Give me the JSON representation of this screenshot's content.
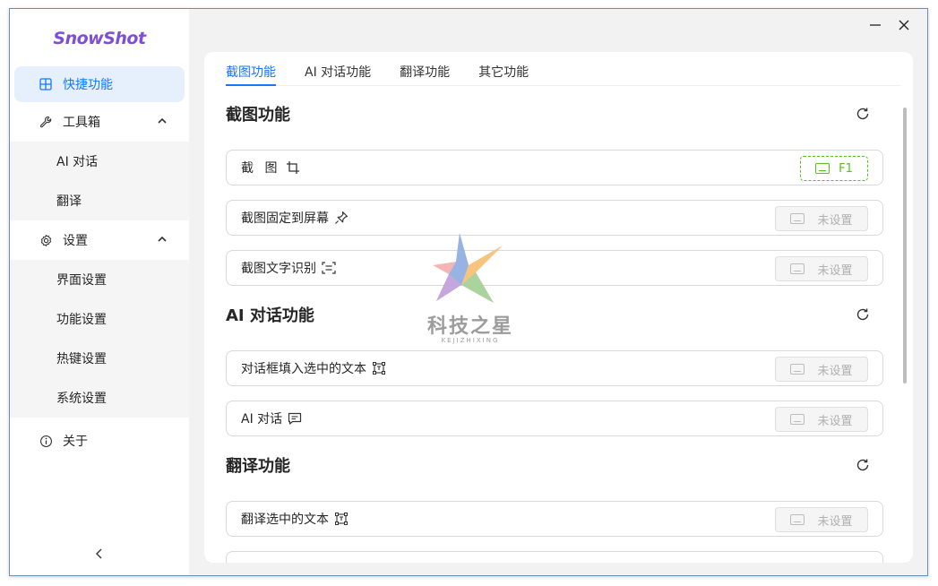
{
  "app": {
    "name": "SnowShot"
  },
  "sidebar": {
    "items": [
      {
        "label": "快捷功能",
        "icon": "layout-grid-icon",
        "active": true
      },
      {
        "label": "工具箱",
        "icon": "wrench-icon",
        "expanded": true,
        "children": [
          "AI 对话",
          "翻译"
        ]
      },
      {
        "label": "设置",
        "icon": "gear-icon",
        "expanded": true,
        "children": [
          "界面设置",
          "功能设置",
          "热键设置",
          "系统设置"
        ]
      },
      {
        "label": "关于",
        "icon": "info-icon"
      }
    ],
    "collapse_icon": "chevron-left-icon"
  },
  "tabs": [
    "截图功能",
    "AI 对话功能",
    "翻译功能",
    "其它功能"
  ],
  "active_tab": 0,
  "sections": [
    {
      "title": "截图功能",
      "rows": [
        {
          "label": "截 图",
          "icon": "crop-icon",
          "hotkey": "F1",
          "hotkey_set": true
        },
        {
          "label": "截图固定到屏幕",
          "icon": "pin-icon",
          "hotkey": "未设置",
          "hotkey_set": false
        },
        {
          "label": "截图文字识别",
          "icon": "scan-text-icon",
          "hotkey": "未设置",
          "hotkey_set": false
        }
      ]
    },
    {
      "title": "AI 对话功能",
      "rows": [
        {
          "label": "对话框填入选中的文本",
          "icon": "text-select-icon",
          "hotkey": "未设置",
          "hotkey_set": false
        },
        {
          "label": "AI 对话",
          "icon": "chat-icon",
          "hotkey": "未设置",
          "hotkey_set": false
        }
      ]
    },
    {
      "title": "翻译功能",
      "rows": [
        {
          "label": "翻译选中的文本",
          "icon": "text-select-icon",
          "hotkey": "未设置",
          "hotkey_set": false
        }
      ]
    }
  ],
  "watermark": {
    "text": "科技之星",
    "sub": "KEJIZHIXING"
  },
  "colors": {
    "accent": "#1677ff",
    "active_bg": "#e6f0fc",
    "hotkey_set": "#52c41a",
    "logo": "#7e4fd6"
  }
}
